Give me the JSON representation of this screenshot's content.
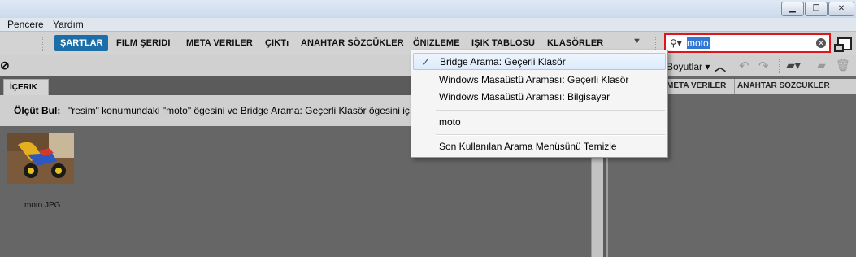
{
  "menubar": {
    "items": [
      "Pencere",
      "Yardım"
    ]
  },
  "workspace_tabs": [
    "ŞARTLAR",
    "FILM ŞERIDI",
    "META VERILER",
    "ÇIKTı",
    "ANAHTAR SÖZCÜKLER",
    "ÖNIZLEME",
    "IŞIK TABLOSU",
    "KLASÖRLER"
  ],
  "search": {
    "value": "moto"
  },
  "toolbar2": {
    "sort_label": "Boyutlar"
  },
  "left_panel": {
    "tab": "İÇERIK",
    "criteria_label": "Ölçüt Bul:",
    "criteria_text": "\"resim\" konumundaki \"moto\" ögesini ve Bridge Arama: Geçerli Klasör ögesini iç",
    "thumbnail_name": "moto.JPG"
  },
  "right_panel": {
    "tabs": [
      "META VERILER",
      "ANAHTAR SÖZCÜKLER"
    ]
  },
  "dropdown": {
    "items": [
      {
        "label": "Bridge Arama: Geçerli Klasör",
        "checked": true
      },
      {
        "label": "Windows Masaüstü Araması: Geçerli Klasör",
        "checked": false
      },
      {
        "label": "Windows Masaüstü Araması: Bilgisayar",
        "checked": false
      },
      {
        "label": "moto",
        "checked": false
      },
      {
        "label": "Son Kullanılan Arama Menüsünü Temizle",
        "checked": false
      }
    ],
    "check_glyph": "✓"
  }
}
